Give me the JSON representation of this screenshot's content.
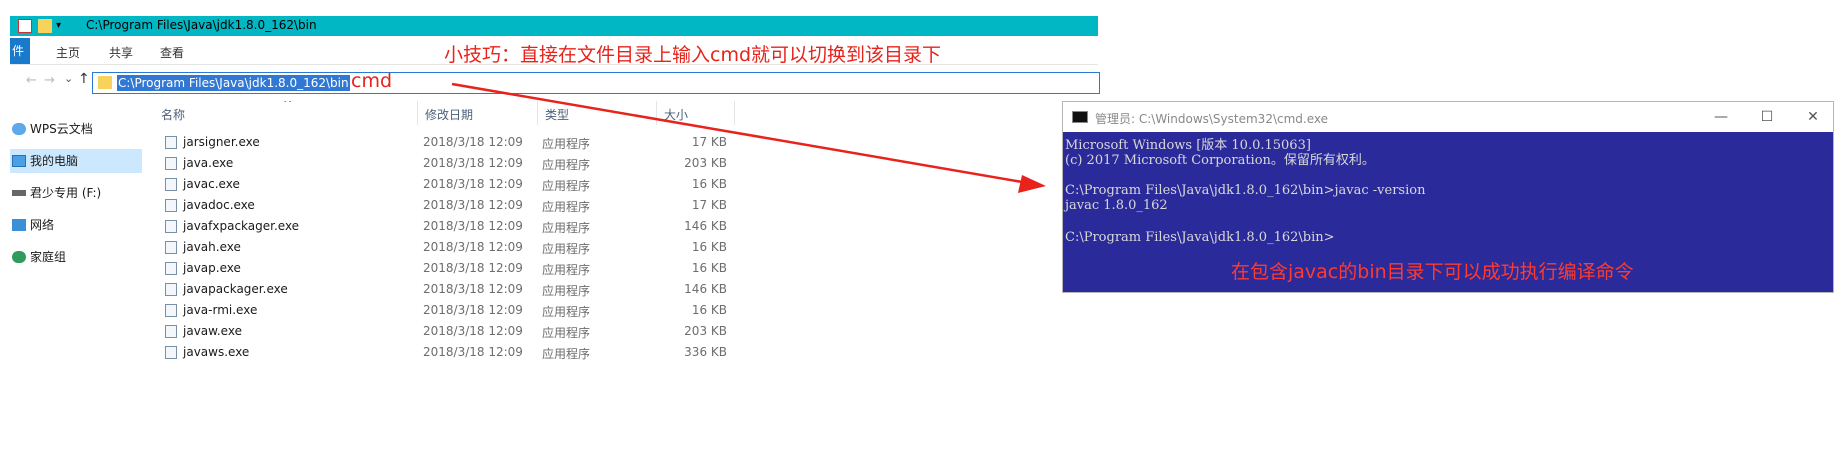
{
  "explorer": {
    "title_path": "C:\\Program Files\\Java\\jdk1.8.0_162\\bin",
    "ribbon_tabs": [
      {
        "label": "件"
      },
      {
        "label": "主页"
      },
      {
        "label": "共享"
      },
      {
        "label": "查看"
      }
    ],
    "address": {
      "selected_path": "C:\\Program Files\\Java\\jdk1.8.0_162\\bin",
      "typed": "cmd"
    },
    "sidebar": [
      {
        "label": "WPS云文档",
        "icon": "cloud-icon"
      },
      {
        "label": "我的电脑",
        "icon": "computer-icon",
        "selected": true
      },
      {
        "label": "君少专用 (F:)",
        "icon": "drive-icon"
      },
      {
        "label": "网络",
        "icon": "network-icon"
      },
      {
        "label": "家庭组",
        "icon": "homegroup-icon"
      }
    ],
    "columns": {
      "name": "名称",
      "modified": "修改日期",
      "type": "类型",
      "size": "大小"
    },
    "files": [
      {
        "name": "jarsigner.exe",
        "date": "2018/3/18 12:09",
        "type": "应用程序",
        "size": "17 KB"
      },
      {
        "name": "java.exe",
        "date": "2018/3/18 12:09",
        "type": "应用程序",
        "size": "203 KB"
      },
      {
        "name": "javac.exe",
        "date": "2018/3/18 12:09",
        "type": "应用程序",
        "size": "16 KB"
      },
      {
        "name": "javadoc.exe",
        "date": "2018/3/18 12:09",
        "type": "应用程序",
        "size": "17 KB"
      },
      {
        "name": "javafxpackager.exe",
        "date": "2018/3/18 12:09",
        "type": "应用程序",
        "size": "146 KB"
      },
      {
        "name": "javah.exe",
        "date": "2018/3/18 12:09",
        "type": "应用程序",
        "size": "16 KB"
      },
      {
        "name": "javap.exe",
        "date": "2018/3/18 12:09",
        "type": "应用程序",
        "size": "16 KB"
      },
      {
        "name": "javapackager.exe",
        "date": "2018/3/18 12:09",
        "type": "应用程序",
        "size": "146 KB"
      },
      {
        "name": "java-rmi.exe",
        "date": "2018/3/18 12:09",
        "type": "应用程序",
        "size": "16 KB"
      },
      {
        "name": "javaw.exe",
        "date": "2018/3/18 12:09",
        "type": "应用程序",
        "size": "203 KB"
      },
      {
        "name": "javaws.exe",
        "date": "2018/3/18 12:09",
        "type": "应用程序",
        "size": "336 KB"
      }
    ]
  },
  "annotations": {
    "tip": "小技巧：直接在文件目录上输入cmd就可以切换到该目录下",
    "cmd_note": "在包含javac的bin目录下可以成功执行编译命令"
  },
  "cmd": {
    "title": "管理员: C:\\Windows\\System32\\cmd.exe",
    "controls": {
      "minimize": "—",
      "maximize": "☐",
      "close": "✕"
    },
    "lines": [
      "Microsoft Windows [版本 10.0.15063]",
      "(c) 2017 Microsoft Corporation。保留所有权利。",
      "",
      "C:\\Program Files\\Java\\jdk1.8.0_162\\bin>javac -version",
      "javac 1.8.0_162",
      "",
      "C:\\Program Files\\Java\\jdk1.8.0_162\\bin>"
    ]
  },
  "colors": {
    "titlebar": "#00b7c3",
    "selection": "#3178d4",
    "annotation": "#e8231c",
    "console_bg": "#2a2a9a"
  }
}
